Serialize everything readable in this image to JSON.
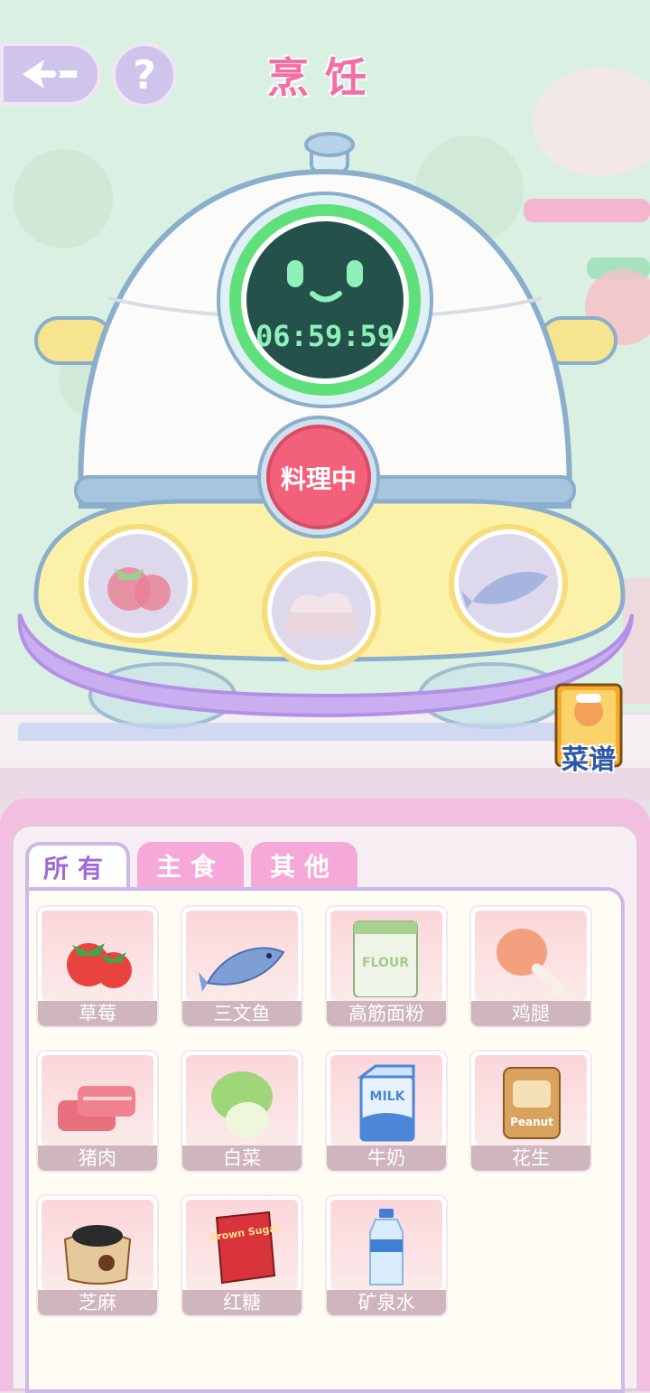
{
  "header": {
    "title": "烹饪",
    "back_icon": "back-arrow-icon",
    "help_label": "?"
  },
  "cooker": {
    "timer": "06:59:59",
    "status_button": "料理中",
    "slots": [
      "strawberry-icon",
      "eggs-icon",
      "salmon-icon"
    ]
  },
  "recipe_book": {
    "label": "菜谱"
  },
  "tabs": [
    {
      "label": "所有",
      "active": true
    },
    {
      "label": "主食",
      "active": false
    },
    {
      "label": "其他",
      "active": false
    }
  ],
  "ingredients": [
    {
      "name": "草莓",
      "icon": "strawberry-icon"
    },
    {
      "name": "三文鱼",
      "icon": "salmon-icon"
    },
    {
      "name": "高筋面粉",
      "icon": "flour-icon",
      "icon_text": "FLOUR"
    },
    {
      "name": "鸡腿",
      "icon": "chicken-leg-icon"
    },
    {
      "name": "猪肉",
      "icon": "pork-icon"
    },
    {
      "name": "白菜",
      "icon": "cabbage-icon"
    },
    {
      "name": "牛奶",
      "icon": "milk-icon",
      "icon_text": "MILK"
    },
    {
      "name": "花生",
      "icon": "peanut-icon",
      "icon_text": "Peanut"
    },
    {
      "name": "芝麻",
      "icon": "sesame-icon"
    },
    {
      "name": "红糖",
      "icon": "brown-sugar-icon",
      "icon_text": "Brown Sugar"
    },
    {
      "name": "矿泉水",
      "icon": "water-bottle-icon"
    }
  ],
  "colors": {
    "title": "#f36fa3",
    "tab_active_text": "#a06ad6",
    "tab_inactive_bg": "#f6a9d8",
    "cook_button": "#f2607a",
    "timer_screen": "#24524a"
  }
}
